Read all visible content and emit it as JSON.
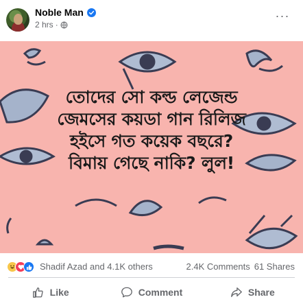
{
  "post": {
    "author": "Noble Man",
    "time": "2 hrs",
    "time_separator": "·"
  },
  "image": {
    "background_color": "#f8b4ae",
    "caption_lines": [
      "তোদের সো কল্ড লেজেন্ড",
      "জেমসের কয়ডা গান রিলিজ",
      "হইসে গত কয়েক বছরে?",
      "বিমায় গেছে নাকি? লুল!"
    ]
  },
  "stats": {
    "reactions": [
      "haha",
      "love",
      "like"
    ],
    "reactors_text": "Shadif Azad and 4.1K others",
    "comments": "2.4K Comments",
    "shares": "61 Shares"
  },
  "actions": {
    "like_label": "Like",
    "comment_label": "Comment",
    "share_label": "Share"
  },
  "colors": {
    "accent": "#1877f2",
    "secondary_text": "#65676b",
    "image_bg": "#f8b4ae"
  }
}
